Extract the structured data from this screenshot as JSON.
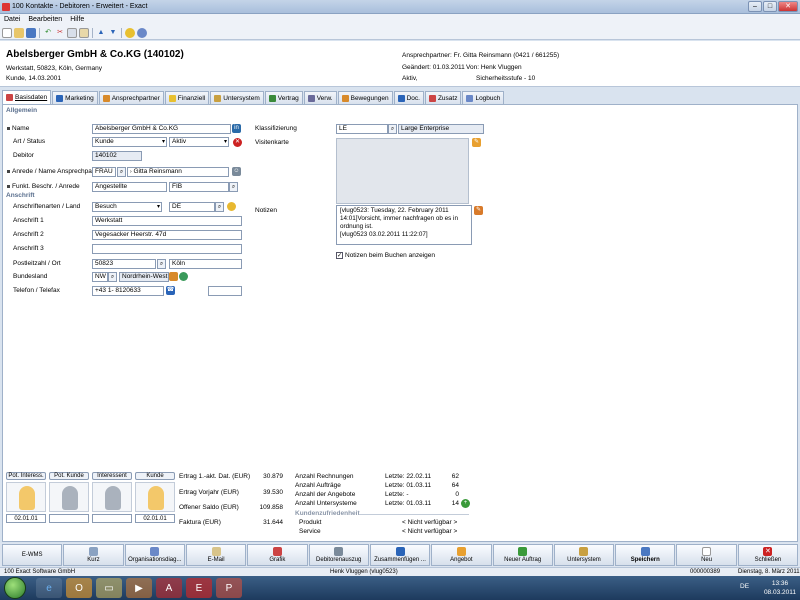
{
  "window": {
    "title": "100 Kontakte - Debitoren - Erweitert - Exact",
    "min": "–",
    "max": "□",
    "close": "✕"
  },
  "menu": [
    "Datei",
    "Bearbeiten",
    "Hilfe"
  ],
  "header": {
    "company": "Abelsberger GmbH & Co.KG (140102)",
    "address": "Werkstatt, 50823, Köln, Germany",
    "kunde": "Kunde, 14.03.2001",
    "ansprechpartner": "Ansprechpartner: Fr. Gitta Reinsmann (0421 / 661255)",
    "geaendert": "Geändert: 01.03.2011",
    "von": "Von: Henk Vluggen",
    "aktiv": "Aktiv,",
    "sicherheit": "Sicherheitsstufe - 10"
  },
  "tabs": [
    "Basisdaten",
    "Marketing",
    "Ansprechpartner",
    "Finanziell",
    "Untersystem",
    "Vertrag",
    "Verw.",
    "Bewegungen",
    "Doc.",
    "Zusatz",
    "Logbuch"
  ],
  "form": {
    "section_allgemein": "Allgemein",
    "section_anschrift": "Anschrift",
    "name_label": "Name",
    "name_value": "Abelsberger GmbH & Co.KG",
    "art_label": "Art / Status",
    "art_value": "Kunde",
    "status_value": "Aktiv",
    "debitor_label": "Debitor",
    "debitor_value": "140102",
    "anrede_label": "Anrede / Name Ansprechpartr",
    "anrede_value": "FRAU",
    "ansprechpartner_value": "Gitta Reinsmann",
    "funkt_label": "Funkt. Beschr. / Anrede",
    "funkt_value": "Angestellte",
    "funkt_code": "FIB",
    "anschriftenarten_label": "Anschriftenarten / Land",
    "anschriftenart_value": "Besuch",
    "land_value": "DE",
    "anschrift1_label": "Anschrift 1",
    "anschrift1_value": "Werkstatt",
    "anschrift2_label": "Anschrift 2",
    "anschrift2_value": "Vegesacker Heerstr. 47d",
    "anschrift3_label": "Anschrift 3",
    "anschrift3_value": "",
    "plz_label": "Postleitzahl / Ort",
    "plz_value": "50823",
    "ort_value": "Köln",
    "bundesland_label": "Bundesland",
    "bundesland_code": "NW",
    "bundesland_value": "Nordrhein-West",
    "telefon_label": "Telefon / Telefax",
    "telefon_value": "+43 1- 8120633",
    "telefax_value": "",
    "klassifizierung_label": "Klassifizierung",
    "klassifizierung_code": "LE",
    "klassifizierung_value": "Large Enterprise",
    "visitenkarte_label": "Visitenkarte",
    "notizen_label": "Notizen",
    "notizen_line1": "[vlug0523: Tuesday, 22. February 2011",
    "notizen_line2": "14:01]Vorsicht, immer nachfragen ob es in",
    "notizen_line3": "ordnung ist.",
    "notizen_line4": "[vlug0523 03.02.2011 11:22:07]",
    "notizen_buchen_label": "Notizen beim Buchen anzeigen"
  },
  "personas": [
    {
      "label": "Pot. Interess.",
      "date": "02.01.01"
    },
    {
      "label": "Pot. Kunde",
      "date": ""
    },
    {
      "label": "Interessent",
      "date": ""
    },
    {
      "label": "Kunde",
      "date": "02.01.01"
    }
  ],
  "finance": {
    "ertrag_label": "Ertrag 1.-akt. Dat. (EUR)",
    "ertrag_value": "30.879",
    "vorjahr_label": "Ertrag Vorjahr (EUR)",
    "vorjahr_value": "39.530",
    "saldo_label": "Offener Saldo (EUR)",
    "saldo_value": "109.858",
    "faktura_label": "Faktura (EUR)",
    "faktura_value": "31.644"
  },
  "counts": [
    {
      "label": "Anzahl Rechnungen",
      "letzte": "Letzte: 22.02.11",
      "value": "62"
    },
    {
      "label": "Anzahl Aufträge",
      "letzte": "Letzte: 01.03.11",
      "value": "64"
    },
    {
      "label": "Anzahl der Angebote",
      "letzte": "Letzte: -",
      "value": "0"
    },
    {
      "label": "Anzahl Untersysteme",
      "letzte": "Letzte: 01.03.11",
      "value": "14"
    }
  ],
  "zufriedenheit": {
    "title": "Kundenzufriedenheit",
    "produkt_label": "Produkt",
    "produkt_value": "< Nicht verfügbar >",
    "service_label": "Service",
    "service_value": "< Nicht verfügbar >"
  },
  "bottom_buttons": [
    "E-WMS",
    "Kurz",
    "Organisationsdiag...",
    "E-Mail",
    "Grafik",
    "Debitorenauszug",
    "Zusammenfügen ...",
    "Angebot",
    "Neuer Auftrag",
    "Untersystem",
    "Speichern",
    "Neu",
    "Schließen"
  ],
  "status": {
    "left": "100 Exact Software GmbH",
    "user": "Henk Vluggen (vlug0523)",
    "code": "000000389",
    "date": "Dienstag, 8. März 2011"
  },
  "taskbar": {
    "lang": "DE",
    "time": "13:36",
    "date": "08.03.2011"
  },
  "colors": {
    "accent": "#2a64b8",
    "header_bg": "#ffffff",
    "window_bg": "#d9e3ef"
  }
}
